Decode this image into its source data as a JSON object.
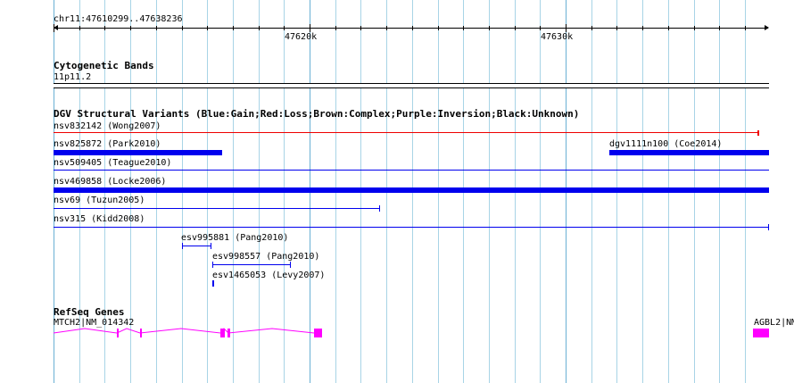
{
  "colors": {
    "gridline": "#a8d4e6",
    "gridline_major": "#6ab0d4",
    "gain": "#0000ee",
    "loss": "#ee0000",
    "gene": "#ff00ff",
    "text": "#000000"
  },
  "ruler": {
    "region_label": "chr11:47610299..47638236",
    "tick_labels": [
      "47620k",
      "47630k"
    ]
  },
  "cytoband": {
    "title": "Cytogenetic Bands",
    "band_label": "11p11.2"
  },
  "dgv": {
    "title": "DGV Structural Variants (Blue:Gain;Red:Loss;Brown:Complex;Purple:Inversion;Black:Unknown)",
    "variants": [
      {
        "label": "nsv832142 (Wong2007)",
        "type": "loss"
      },
      {
        "label": "nsv825872 (Park2010)",
        "type": "gain"
      },
      {
        "label": "dgv1111n100 (Coe2014)",
        "type": "gain"
      },
      {
        "label": "nsv509405 (Teague2010)",
        "type": "gain"
      },
      {
        "label": "nsv469858 (Locke2006)",
        "type": "gain"
      },
      {
        "label": "nsv69 (Tuzun2005)",
        "type": "gain"
      },
      {
        "label": "nsv315 (Kidd2008)",
        "type": "gain"
      },
      {
        "label": "esv995881 (Pang2010)",
        "type": "gain"
      },
      {
        "label": "esv998557 (Pang2010)",
        "type": "gain"
      },
      {
        "label": "esv1465053 (Levy2007)",
        "type": "gain"
      }
    ]
  },
  "refseq": {
    "title": "RefSeq Genes",
    "genes": [
      {
        "label": "MTCH2|NM_014342"
      },
      {
        "label": "AGBL2|NM"
      }
    ]
  }
}
